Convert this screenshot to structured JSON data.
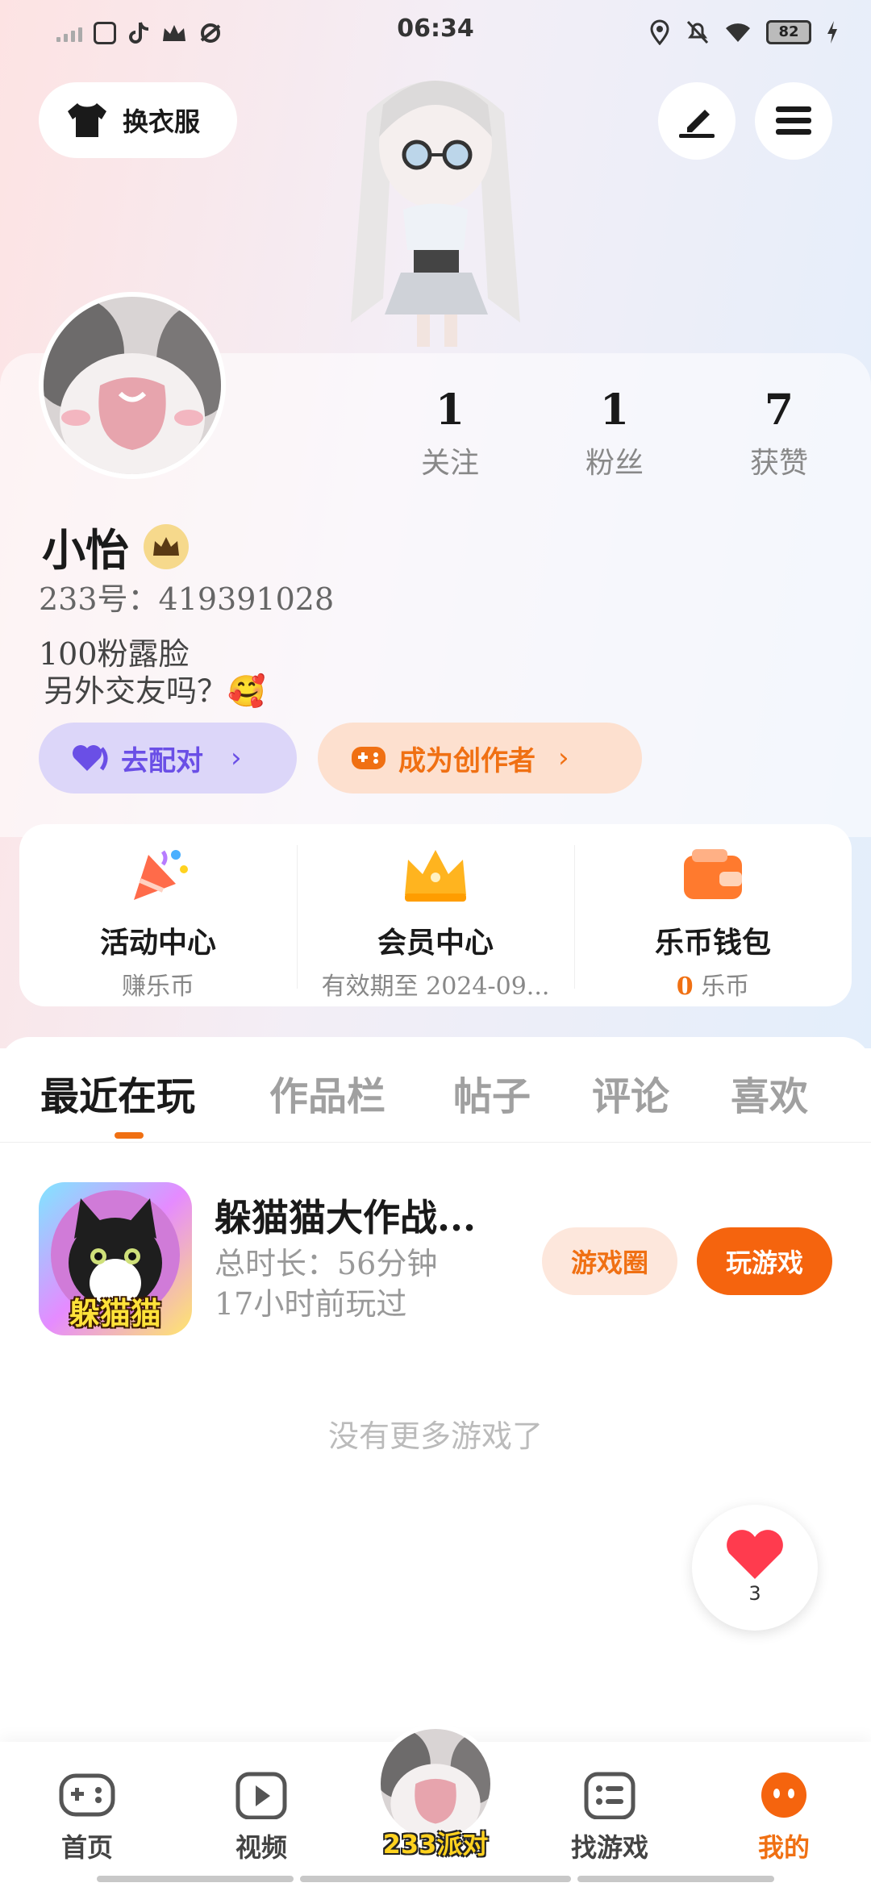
{
  "status_bar": {
    "time": "06:34",
    "battery": "82"
  },
  "header": {
    "outfit_label": "换衣服"
  },
  "profile": {
    "stats": [
      {
        "value": "1",
        "label": "关注"
      },
      {
        "value": "1",
        "label": "粉丝"
      },
      {
        "value": "7",
        "label": "获赞"
      }
    ],
    "name": "小怡",
    "uid": "233号：419391028",
    "bio_line1": "100粉露脸",
    "bio_line2": "另外交友吗？🥰",
    "match_label": "去配对",
    "creator_label": "成为创作者"
  },
  "quick_entries": [
    {
      "title": "活动中心",
      "sub": "赚乐币"
    },
    {
      "title": "会员中心",
      "sub": "有效期至 2024-09..."
    },
    {
      "title": "乐币钱包",
      "sub_value": "0",
      "sub_unit": "乐币"
    }
  ],
  "tabs": [
    {
      "label": "最近在玩",
      "active": true
    },
    {
      "label": "作品栏"
    },
    {
      "label": "帖子"
    },
    {
      "label": "评论"
    },
    {
      "label": "喜欢"
    }
  ],
  "recent_game": {
    "title": "躲猫猫大作战...",
    "icon_text": "躲猫猫",
    "play_time": "总时长：56分钟",
    "last_played": "17小时前玩过",
    "circle_btn": "游戏圈",
    "play_btn": "玩游戏"
  },
  "no_more_text": "没有更多游戏了",
  "like_fab": {
    "count": "3"
  },
  "bottom_nav": {
    "items": [
      {
        "label": "首页"
      },
      {
        "label": "视频"
      },
      {
        "label": "233派对"
      },
      {
        "label": "找游戏"
      },
      {
        "label": "我的"
      }
    ]
  },
  "colors": {
    "accent": "#f07013",
    "match": "#6a4fe6",
    "gold": "#ffc21f"
  }
}
